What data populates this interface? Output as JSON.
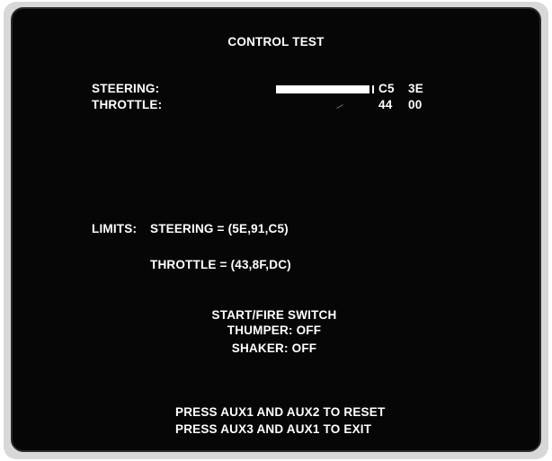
{
  "screen": {
    "title": "CONTROL TEST",
    "readouts": [
      {
        "label": "STEERING:",
        "value1": "C5",
        "value2": "3E"
      },
      {
        "label": "THROTTLE:",
        "value1": "44",
        "value2": "00"
      }
    ],
    "steering_bar_level": 0.55,
    "limits": {
      "label": "LIMITS:",
      "steering": "STEERING = (5E,91,C5)",
      "throttle": "THROTTLE = (43,8F,DC)"
    },
    "switches": {
      "start_fire": "START/FIRE SWITCH",
      "thumper": "THUMPER: OFF",
      "shaker": "SHAKER: OFF"
    },
    "instructions": {
      "reset": "PRESS AUX1 AND AUX2 TO RESET",
      "exit": "PRESS AUX3 AND AUX1 TO EXIT"
    }
  }
}
